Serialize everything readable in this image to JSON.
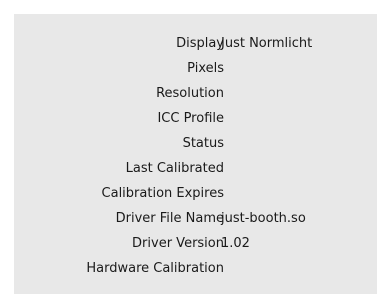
{
  "info_panel": {
    "rows": [
      {
        "label": "Display",
        "value": "Just Normlicht"
      },
      {
        "label": "Pixels",
        "value": ""
      },
      {
        "label": "Resolution",
        "value": ""
      },
      {
        "label": "ICC Profile",
        "value": ""
      },
      {
        "label": "Status",
        "value": ""
      },
      {
        "label": "Last Calibrated",
        "value": ""
      },
      {
        "label": "Calibration Expires",
        "value": ""
      },
      {
        "label": "Driver File Name",
        "value": "just-booth.so"
      },
      {
        "label": "Driver Version",
        "value": "1.02"
      },
      {
        "label": "Hardware Calibration",
        "value": ""
      }
    ]
  }
}
